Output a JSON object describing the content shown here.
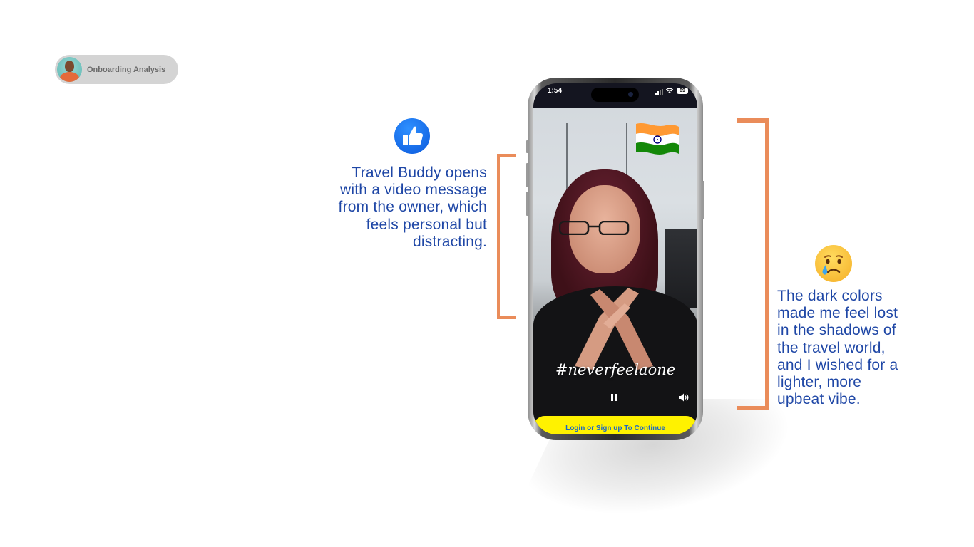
{
  "badge": {
    "label": "Onboarding Analysis"
  },
  "left_note": {
    "lines": [
      "Travel Buddy opens",
      "with a video message",
      "from the owner, which",
      "feels personal but",
      "distracting."
    ]
  },
  "right_note": {
    "lines": [
      "The dark colors",
      "made me feel lost",
      "in the shadows of",
      "the travel world,",
      "and I wished for a",
      "lighter, more",
      "upbeat vibe."
    ]
  },
  "phone": {
    "status_time": "1:54",
    "battery": "89",
    "hashtag": "#neverfeelaone",
    "cta": "Login or Sign up To Continue"
  },
  "icons": {
    "positive": "thumbs-up-icon",
    "negative": "crying-face-icon",
    "flag": "india-flag-icon"
  },
  "colors": {
    "annotation_text": "#1f47a6",
    "bracket": "#ea8c5a",
    "cta_background": "#fff200",
    "cta_text": "#1b67c7"
  }
}
